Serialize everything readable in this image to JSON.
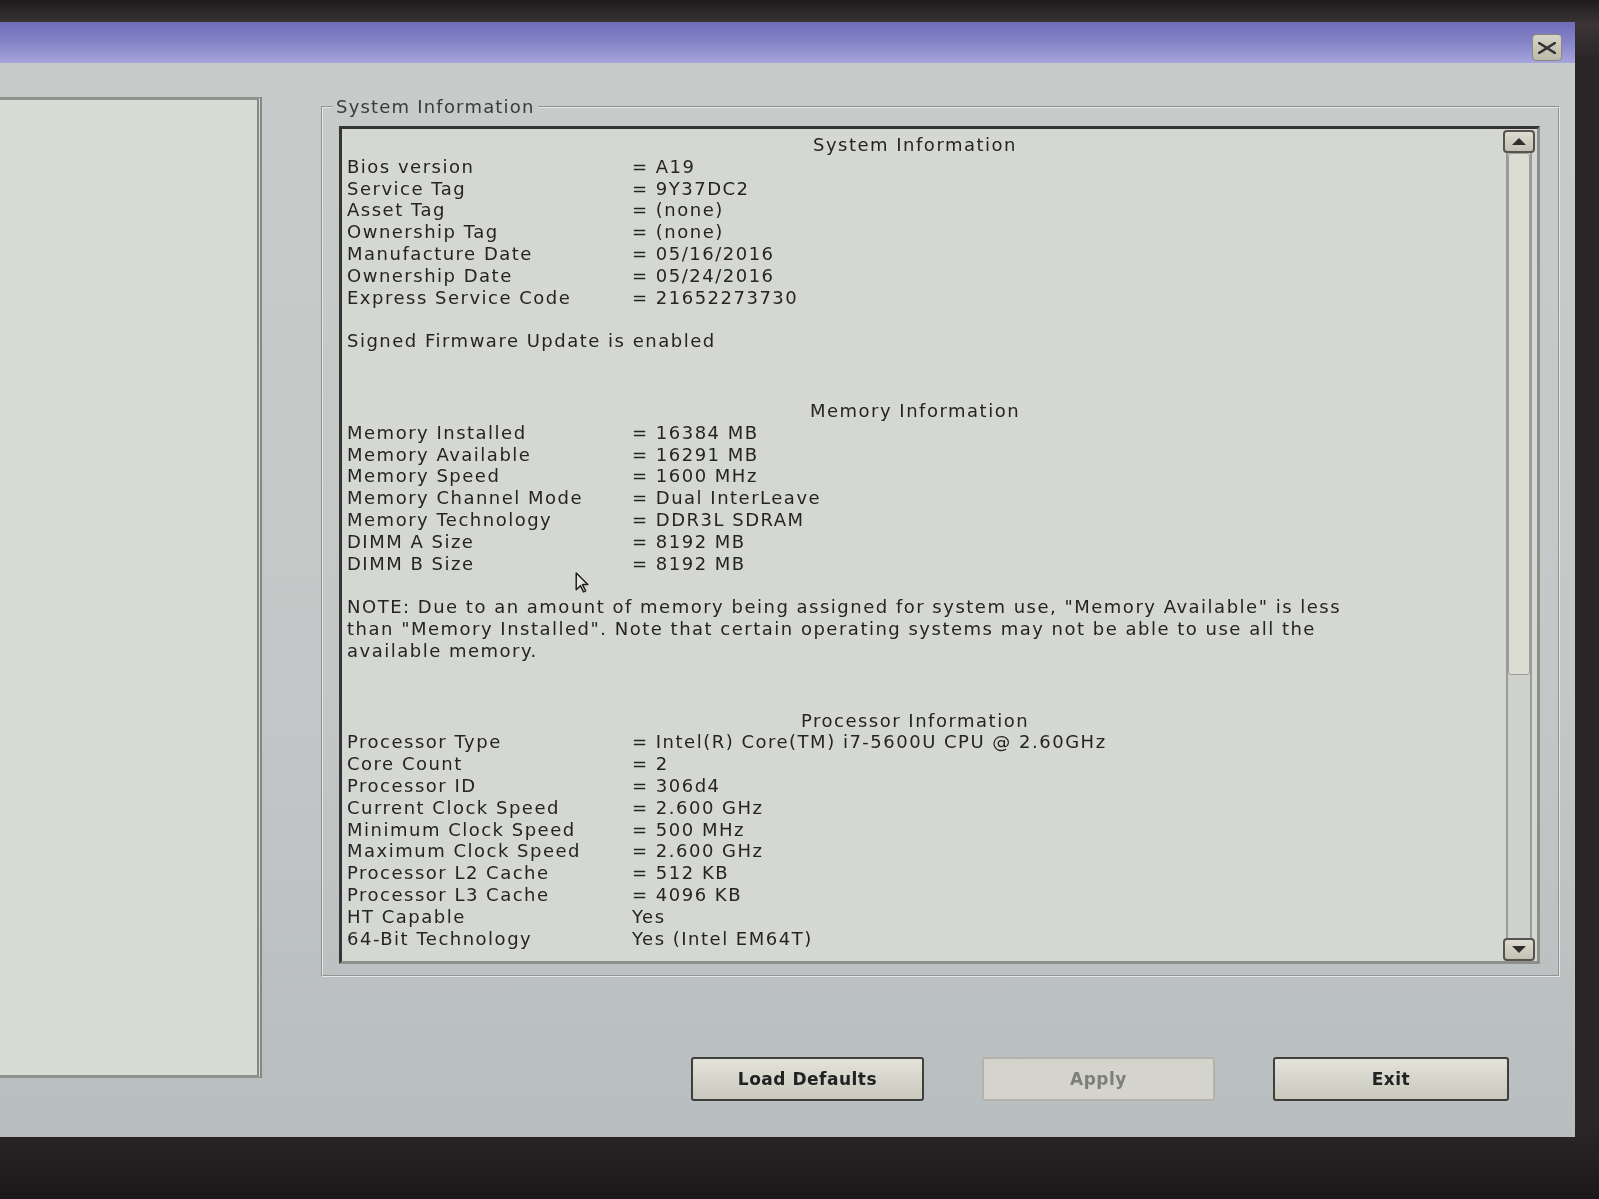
{
  "group_box": {
    "title": "System Information",
    "sections": [
      {
        "heading": "System Information",
        "rows": [
          {
            "label": "Bios version",
            "value": "= A19"
          },
          {
            "label": "Service Tag",
            "value": "= 9Y37DC2"
          },
          {
            "label": "Asset Tag",
            "value": "= (none)"
          },
          {
            "label": "Ownership Tag",
            "value": "= (none)"
          },
          {
            "label": "Manufacture Date",
            "value": "= 05/16/2016"
          },
          {
            "label": "Ownership Date",
            "value": "= 05/24/2016"
          },
          {
            "label": "Express Service Code",
            "value": "= 21652273730"
          }
        ],
        "note": "Signed Firmware Update is enabled"
      },
      {
        "heading": "Memory Information",
        "rows": [
          {
            "label": "Memory Installed",
            "value": "= 16384 MB"
          },
          {
            "label": "Memory Available",
            "value": "= 16291 MB"
          },
          {
            "label": "Memory Speed",
            "value": "= 1600 MHz"
          },
          {
            "label": "Memory Channel Mode",
            "value": "= Dual InterLeave"
          },
          {
            "label": "Memory Technology",
            "value": "= DDR3L SDRAM"
          },
          {
            "label": "DIMM A Size",
            "value": "= 8192 MB"
          },
          {
            "label": "DIMM B Size",
            "value": "= 8192 MB"
          }
        ],
        "note": "NOTE: Due to an amount of memory being assigned for system use, \"Memory Available\" is less than \"Memory Installed\". Note that certain operating systems may not be able to use all the available memory."
      },
      {
        "heading": "Processor Information",
        "rows": [
          {
            "label": "Processor Type",
            "value": "= Intel(R) Core(TM) i7-5600U CPU @ 2.60GHz"
          },
          {
            "label": "Core Count",
            "value": "= 2"
          },
          {
            "label": "Processor ID",
            "value": "= 306d4"
          },
          {
            "label": "Current Clock Speed",
            "value": "= 2.600 GHz"
          },
          {
            "label": "Minimum Clock Speed",
            "value": "= 500 MHz"
          },
          {
            "label": "Maximum Clock Speed",
            "value": "= 2.600 GHz"
          },
          {
            "label": "Processor L2 Cache",
            "value": "= 512 KB"
          },
          {
            "label": "Processor L3 Cache",
            "value": "= 4096 KB"
          },
          {
            "label": "HT Capable",
            "value": "Yes"
          },
          {
            "label": "64-Bit Technology",
            "value": "Yes (Intel EM64T)"
          }
        ]
      }
    ]
  },
  "buttons": [
    {
      "label": "Load Defaults",
      "disabled": false
    },
    {
      "label": "Apply",
      "disabled": true
    },
    {
      "label": "Exit",
      "disabled": false
    }
  ]
}
